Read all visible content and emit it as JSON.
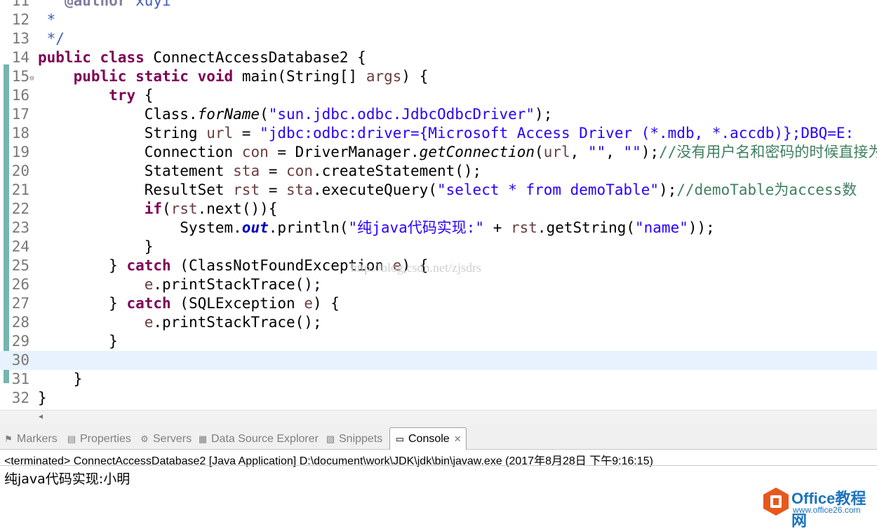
{
  "editor": {
    "lines": [
      {
        "num": "11",
        "parts": [
          {
            "t": "   ",
            "c": ""
          },
          {
            "t": "@author",
            "c": "tag"
          },
          {
            "t": " xuyi",
            "c": "doc"
          }
        ]
      },
      {
        "num": "12",
        "parts": [
          {
            "t": " *",
            "c": "doc"
          }
        ]
      },
      {
        "num": "13",
        "parts": [
          {
            "t": " */",
            "c": "doc"
          }
        ]
      },
      {
        "num": "14",
        "parts": [
          {
            "t": "public",
            "c": "kw"
          },
          {
            "t": " ",
            "c": ""
          },
          {
            "t": "class",
            "c": "kw"
          },
          {
            "t": " ConnectAccessDatabase2 {",
            "c": ""
          }
        ]
      },
      {
        "num": "15",
        "fold": true,
        "parts": [
          {
            "t": "    ",
            "c": ""
          },
          {
            "t": "public",
            "c": "kw"
          },
          {
            "t": " ",
            "c": ""
          },
          {
            "t": "static",
            "c": "kw"
          },
          {
            "t": " ",
            "c": ""
          },
          {
            "t": "void",
            "c": "kw"
          },
          {
            "t": " main(String[] ",
            "c": ""
          },
          {
            "t": "args",
            "c": "var"
          },
          {
            "t": ") {",
            "c": ""
          }
        ]
      },
      {
        "num": "16",
        "parts": [
          {
            "t": "        ",
            "c": ""
          },
          {
            "t": "try",
            "c": "kw"
          },
          {
            "t": " {",
            "c": ""
          }
        ]
      },
      {
        "num": "17",
        "parts": [
          {
            "t": "            Class.",
            "c": ""
          },
          {
            "t": "forName",
            "c": "itl"
          },
          {
            "t": "(",
            "c": ""
          },
          {
            "t": "\"sun.jdbc.odbc.JdbcOdbcDriver\"",
            "c": "str"
          },
          {
            "t": ");",
            "c": ""
          }
        ]
      },
      {
        "num": "18",
        "parts": [
          {
            "t": "            String ",
            "c": ""
          },
          {
            "t": "url",
            "c": "var"
          },
          {
            "t": " = ",
            "c": ""
          },
          {
            "t": "\"jdbc:odbc:driver={Microsoft Access Driver (*.mdb, *.accdb)};DBQ=E:",
            "c": "str"
          }
        ]
      },
      {
        "num": "19",
        "parts": [
          {
            "t": "            Connection ",
            "c": ""
          },
          {
            "t": "con",
            "c": "var"
          },
          {
            "t": " = DriverManager.",
            "c": ""
          },
          {
            "t": "getConnection",
            "c": "itl"
          },
          {
            "t": "(",
            "c": ""
          },
          {
            "t": "url",
            "c": "var"
          },
          {
            "t": ", ",
            "c": ""
          },
          {
            "t": "\"\"",
            "c": "str"
          },
          {
            "t": ", ",
            "c": ""
          },
          {
            "t": "\"\"",
            "c": "str"
          },
          {
            "t": ");",
            "c": ""
          },
          {
            "t": "//没有用户名和密码的时候直接为",
            "c": "cmt"
          }
        ]
      },
      {
        "num": "20",
        "parts": [
          {
            "t": "            Statement ",
            "c": ""
          },
          {
            "t": "sta",
            "c": "var"
          },
          {
            "t": " = ",
            "c": ""
          },
          {
            "t": "con",
            "c": "var"
          },
          {
            "t": ".createStatement();",
            "c": ""
          }
        ]
      },
      {
        "num": "21",
        "parts": [
          {
            "t": "            ResultSet ",
            "c": ""
          },
          {
            "t": "rst",
            "c": "var"
          },
          {
            "t": " = ",
            "c": ""
          },
          {
            "t": "sta",
            "c": "var"
          },
          {
            "t": ".executeQuery(",
            "c": ""
          },
          {
            "t": "\"select * from demoTable\"",
            "c": "str"
          },
          {
            "t": ");",
            "c": ""
          },
          {
            "t": "//demoTable为access数",
            "c": "cmt"
          }
        ]
      },
      {
        "num": "22",
        "parts": [
          {
            "t": "            ",
            "c": ""
          },
          {
            "t": "if",
            "c": "kw"
          },
          {
            "t": "(",
            "c": ""
          },
          {
            "t": "rst",
            "c": "var"
          },
          {
            "t": ".next()){",
            "c": ""
          }
        ]
      },
      {
        "num": "23",
        "parts": [
          {
            "t": "                System.",
            "c": ""
          },
          {
            "t": "out",
            "c": "fld"
          },
          {
            "t": ".println(",
            "c": ""
          },
          {
            "t": "\"纯java代码实现:\"",
            "c": "str"
          },
          {
            "t": " + ",
            "c": ""
          },
          {
            "t": "rst",
            "c": "var"
          },
          {
            "t": ".getString(",
            "c": ""
          },
          {
            "t": "\"name\"",
            "c": "str"
          },
          {
            "t": "));",
            "c": ""
          }
        ]
      },
      {
        "num": "24",
        "parts": [
          {
            "t": "            }",
            "c": ""
          }
        ]
      },
      {
        "num": "25",
        "parts": [
          {
            "t": "        } ",
            "c": ""
          },
          {
            "t": "catch",
            "c": "kw"
          },
          {
            "t": " (ClassNotFoundException ",
            "c": ""
          },
          {
            "t": "e",
            "c": "var"
          },
          {
            "t": ") {",
            "c": ""
          }
        ]
      },
      {
        "num": "26",
        "parts": [
          {
            "t": "            ",
            "c": ""
          },
          {
            "t": "e",
            "c": "var"
          },
          {
            "t": ".printStackTrace();",
            "c": ""
          }
        ]
      },
      {
        "num": "27",
        "parts": [
          {
            "t": "        } ",
            "c": ""
          },
          {
            "t": "catch",
            "c": "kw"
          },
          {
            "t": " (SQLException ",
            "c": ""
          },
          {
            "t": "e",
            "c": "var"
          },
          {
            "t": ") {",
            "c": ""
          }
        ]
      },
      {
        "num": "28",
        "parts": [
          {
            "t": "            ",
            "c": ""
          },
          {
            "t": "e",
            "c": "var"
          },
          {
            "t": ".printStackTrace();",
            "c": ""
          }
        ]
      },
      {
        "num": "29",
        "parts": [
          {
            "t": "        }",
            "c": ""
          }
        ]
      },
      {
        "num": "30",
        "current": true,
        "parts": []
      },
      {
        "num": "31",
        "parts": [
          {
            "t": "    }",
            "c": ""
          }
        ]
      },
      {
        "num": "32",
        "parts": [
          {
            "t": "}",
            "c": ""
          }
        ]
      }
    ],
    "watermark": "http://blog.csdn.net/zjsdrs"
  },
  "panel": {
    "tabs": [
      {
        "name": "markers",
        "label": "Markers",
        "icon": "markers-icon",
        "glyph": "⚑"
      },
      {
        "name": "properties",
        "label": "Properties",
        "icon": "properties-icon",
        "glyph": "▤"
      },
      {
        "name": "servers",
        "label": "Servers",
        "icon": "servers-icon",
        "glyph": "⚙"
      },
      {
        "name": "data-source-explorer",
        "label": "Data Source Explorer",
        "icon": "database-icon",
        "glyph": "▦"
      },
      {
        "name": "snippets",
        "label": "Snippets",
        "icon": "snippets-icon",
        "glyph": "▧"
      },
      {
        "name": "console",
        "label": "Console",
        "icon": "console-icon",
        "glyph": "▭",
        "active": true
      }
    ],
    "console_status": "<terminated> ConnectAccessDatabase2 [Java Application] D:\\document\\work\\JDK\\jdk\\bin\\javaw.exe (2017年8月28日 下午9:16:15)",
    "console_output": "纯java代码实现:小明"
  },
  "logo": {
    "text": "Office教程网",
    "url_text": "www.office26.com"
  },
  "colors": {
    "keyword": "#7f0055",
    "string": "#2a00ff",
    "comment": "#3f7f5f",
    "variable": "#6a3e3e",
    "accent": "#76b5b0"
  }
}
